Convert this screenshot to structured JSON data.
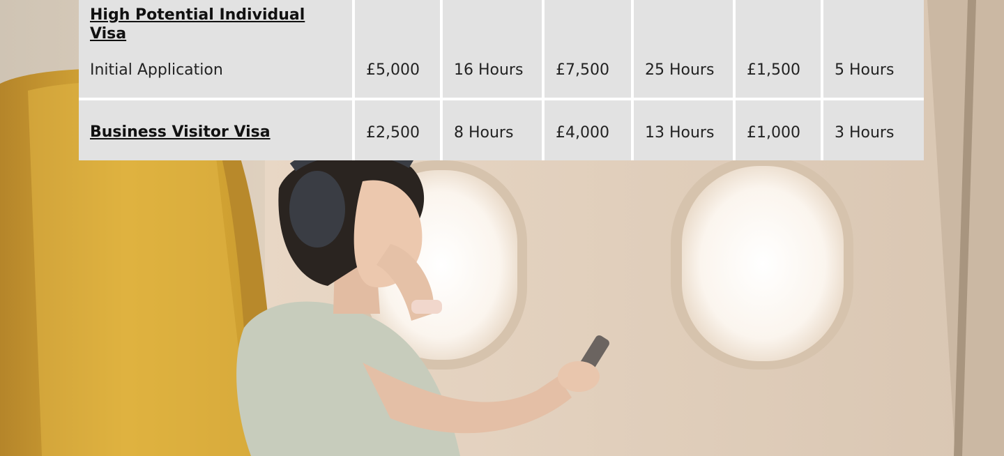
{
  "pricing_table": {
    "rows": [
      {
        "visa": "High Potential Individual Visa",
        "sub_label": "Initial Application",
        "cells": [
          "£5,000",
          "16 Hours",
          "£7,500",
          "25 Hours",
          "£1,500",
          "5 Hours"
        ]
      },
      {
        "visa": "Business Visitor Visa",
        "sub_label": "",
        "cells": [
          "£2,500",
          "8 Hours",
          "£4,000",
          "13 Hours",
          "£1,000",
          "3 Hours"
        ]
      }
    ]
  },
  "colors": {
    "cell_background": "#e2e2e2",
    "cell_border": "#ffffff",
    "text": "#222222",
    "seat": "#d8a92c"
  }
}
